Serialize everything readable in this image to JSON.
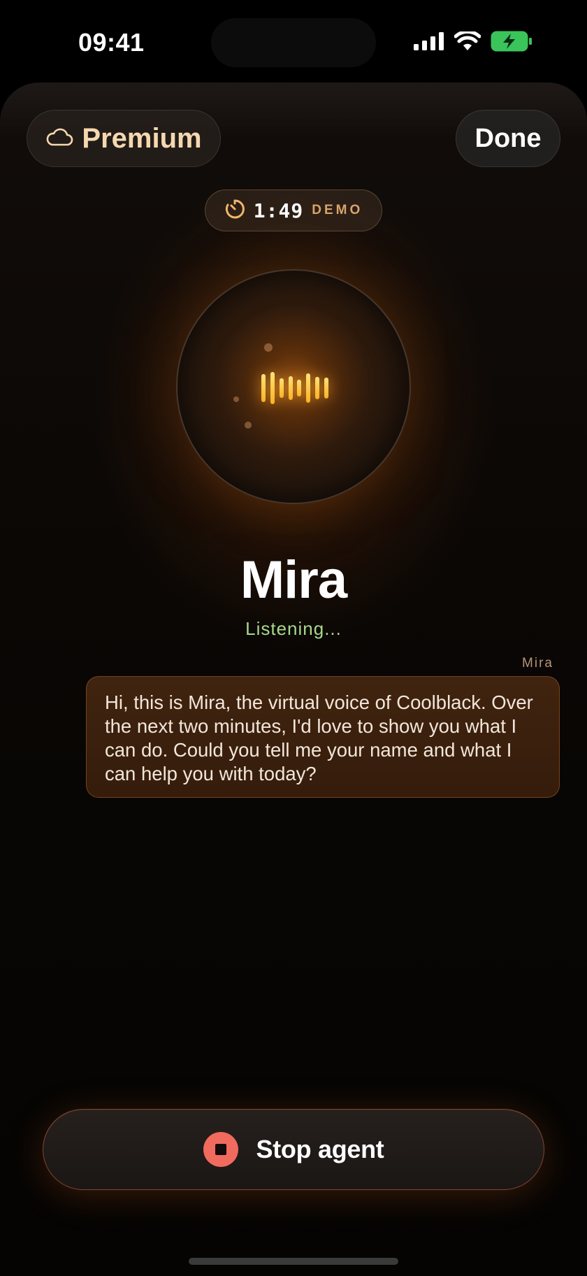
{
  "status_bar": {
    "time": "09:41",
    "icons": [
      "signal-icon",
      "wifi-icon",
      "battery-charging-icon"
    ],
    "battery_color": "#3ac45a"
  },
  "header": {
    "premium_label": "Premium",
    "premium_icon": "cloud-icon",
    "done_label": "Done"
  },
  "timer": {
    "icon": "timer-icon",
    "value": "1:49",
    "tag": "DEMO"
  },
  "agent": {
    "name": "Mira",
    "status": "Listening...",
    "waveform_icon": "waveform-icon"
  },
  "message": {
    "speaker": "Mira",
    "text": "Hi, this is Mira, the virtual voice of Coolblack. Over the next two minutes, I'd love to show you what I can do. Could you tell me your name and what I can help you with today?"
  },
  "stop_button": {
    "label": "Stop agent",
    "icon": "stop-icon"
  },
  "colors": {
    "accent": "#f6d8b0",
    "status_green": "#a8d98a",
    "stop_red": "#f06a5e",
    "bubble_bg": "#3a200d"
  }
}
